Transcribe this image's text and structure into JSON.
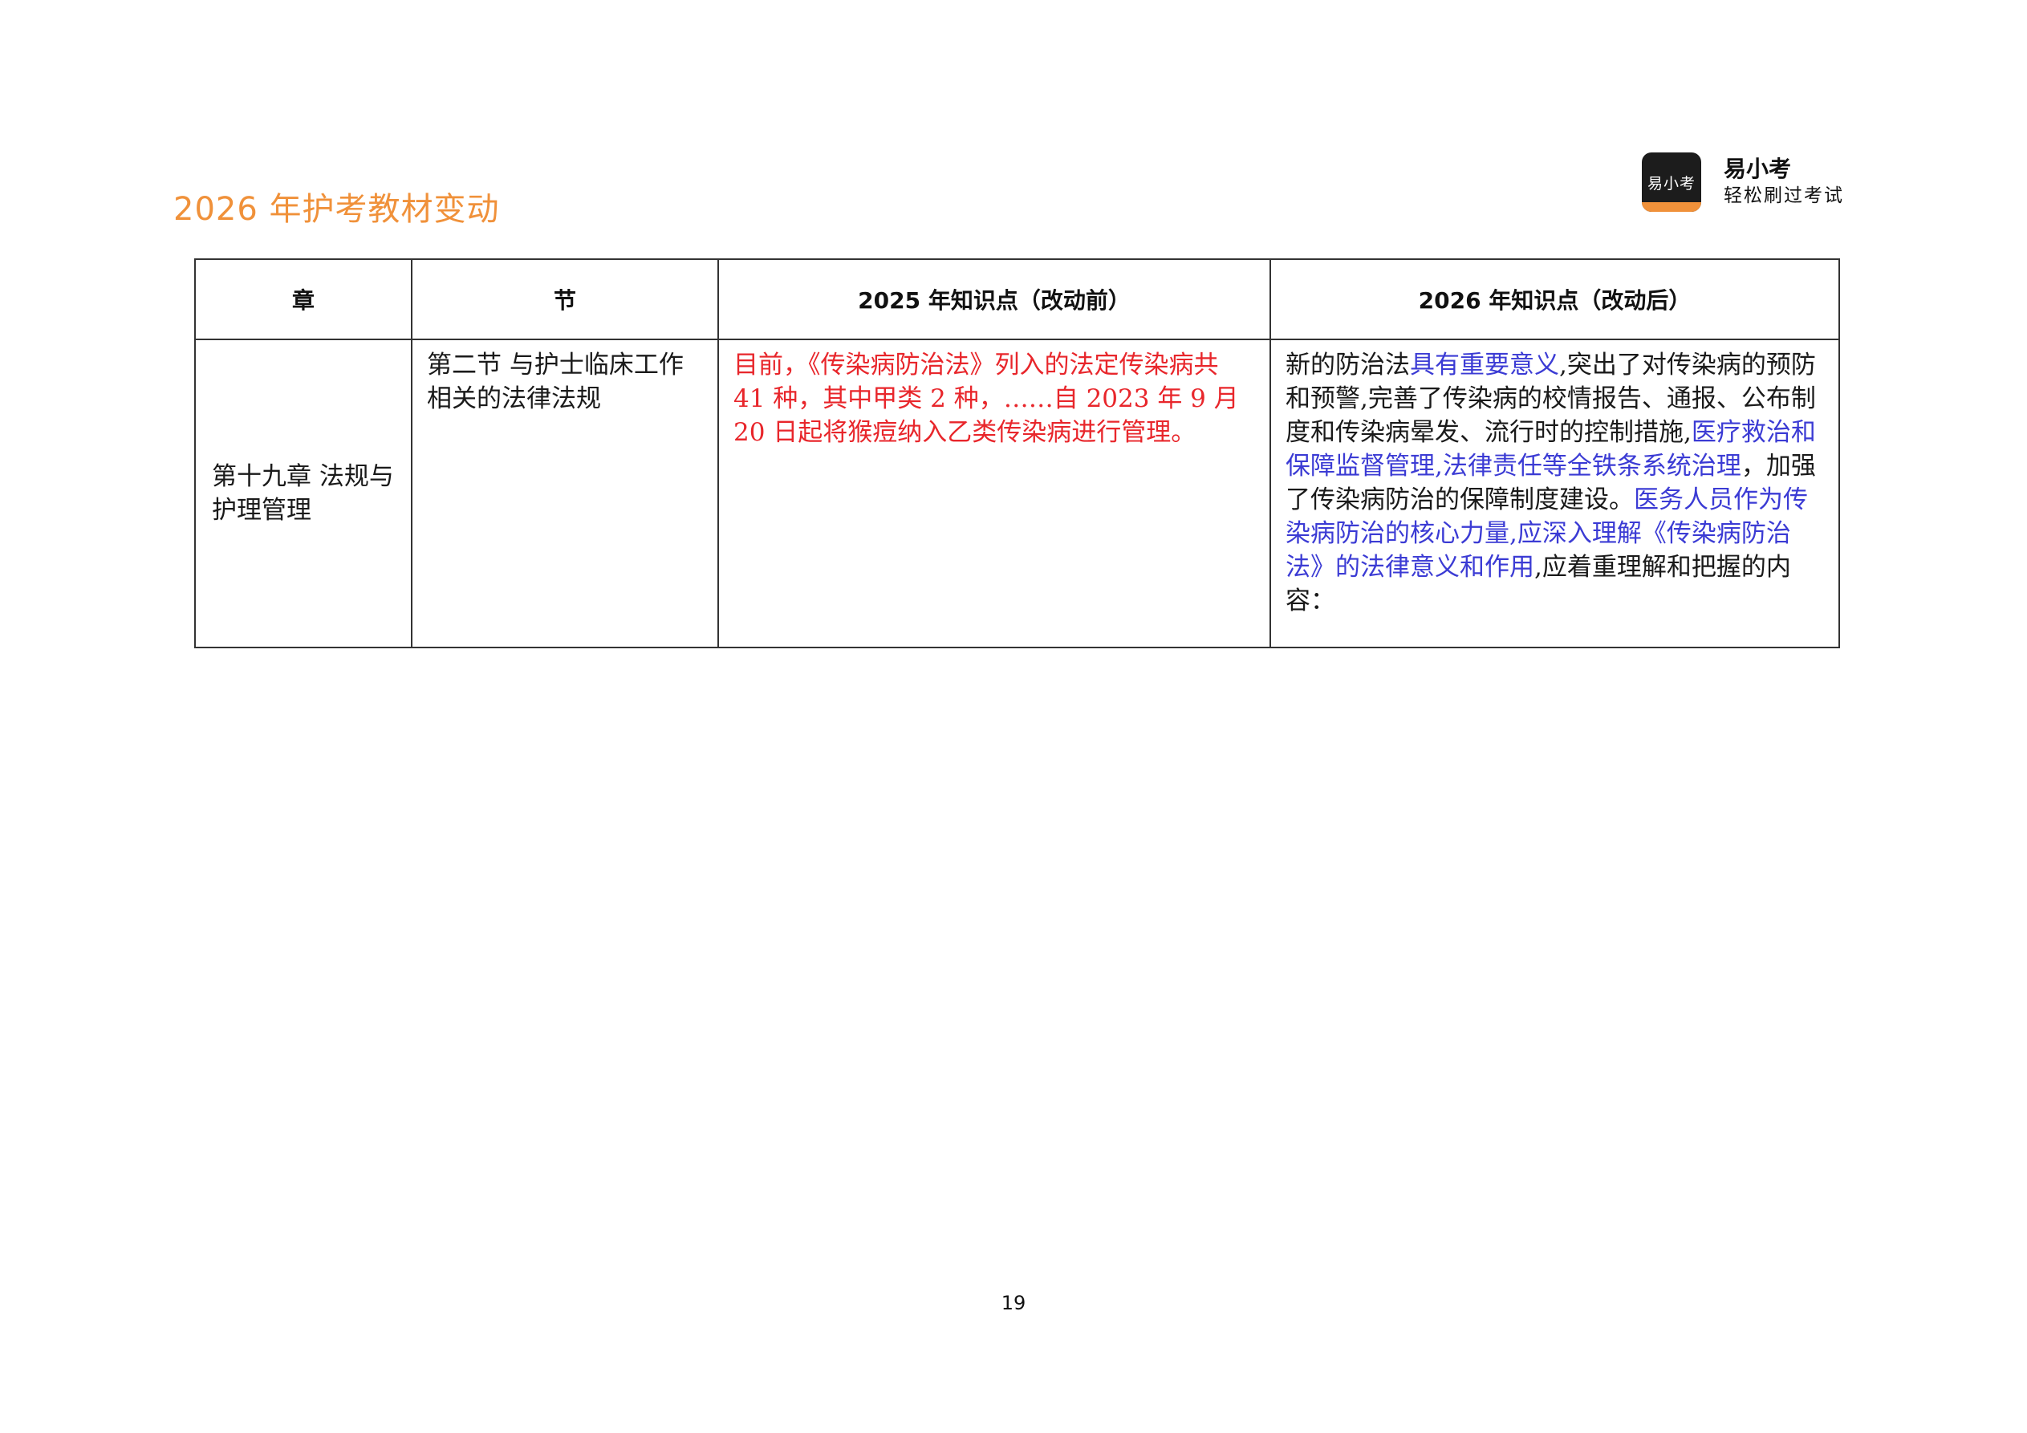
{
  "header": {
    "title": "2026 年护考教材变动",
    "brand_logo_text": "易小考",
    "brand_name": "易小考",
    "brand_slogan": "轻松刷过考试"
  },
  "table": {
    "columns": [
      "章",
      "节",
      "2025 年知识点（改动前）",
      "2026 年知识点（改动后）"
    ],
    "rows": [
      {
        "chapter": "第十九章 法规与护理管理",
        "section": "第二节 与护士临床工作相关的法律法规",
        "before": "目前，《传染病防治法》列入的法定传染病共 41 种，其中甲类 2 种，……自 2023 年 9 月 20 日起将猴痘纳入乙类传染病进行管理。",
        "after_segments": [
          {
            "text": "新的防治法",
            "style": "black"
          },
          {
            "text": "具有重要意义",
            "style": "blue"
          },
          {
            "text": ",突出了对传染病的预防和预警,完善了传染病的校情报告、通报、公布制度和传染病晕发、流行时的控制措施,",
            "style": "black"
          },
          {
            "text": "医疗救治和保障监督管理,法律责任等全铁条系统治理",
            "style": "blue"
          },
          {
            "text": "，加强了传染病防治的保障制度建设。",
            "style": "black"
          },
          {
            "text": "医务人员作为传染病防治的核心力量,应深入理解《传染病防治法》的法律意义和作用",
            "style": "blue"
          },
          {
            "text": ",应着重理解和把握的内容：",
            "style": "black"
          }
        ]
      }
    ]
  },
  "footer": {
    "page_number": "19"
  },
  "colors": {
    "title_orange": "#f0913a",
    "before_red": "#e8262b",
    "after_blue": "#3b3bd4"
  }
}
